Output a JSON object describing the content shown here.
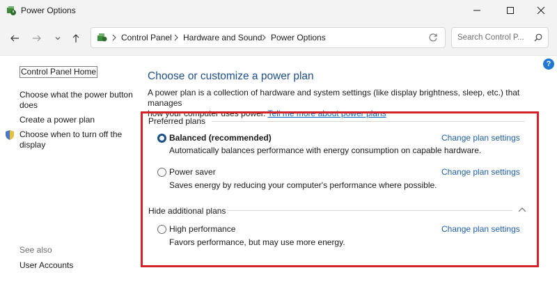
{
  "window": {
    "title": "Power Options"
  },
  "address": {
    "crumbs": [
      "Control Panel",
      "Hardware and Sound",
      "Power Options"
    ],
    "search_placeholder": "Search Control P..."
  },
  "sidebar": {
    "home": "Control Panel Home",
    "links": [
      {
        "label_line1": "Choose what the power button",
        "label_line2": "does"
      },
      {
        "label_line1": "Create a power plan"
      },
      {
        "label_line1": "Choose when to turn off the",
        "label_line2": "display"
      }
    ],
    "see_also": "See also",
    "user_accounts": "User Accounts"
  },
  "main": {
    "title": "Choose or customize a power plan",
    "description_line1": "A power plan is a collection of hardware and system settings (like display brightness, sleep, etc.) that manages",
    "description_line2_text": "how your computer uses power.",
    "description_link": "Tell me more about power plans",
    "preferred_label": "Preferred plans",
    "hide_label": "Hide additional plans",
    "change_link": "Change plan settings",
    "plans": [
      {
        "name": "Balanced (recommended)",
        "description": "Automatically balances performance with energy consumption on capable hardware.",
        "selected": true
      },
      {
        "name": "Power saver",
        "description": "Saves energy by reducing your computer's performance where possible.",
        "selected": false
      },
      {
        "name": "High performance",
        "description": "Favors performance, but may use more energy.",
        "selected": false
      }
    ]
  },
  "colors": {
    "accent": "#1e4e8c",
    "link": "#1f5fa8",
    "highlight_box": "#d2232a"
  },
  "icons": [
    "power-options-icon",
    "minimize-icon",
    "maximize-icon",
    "close-icon",
    "back-arrow-icon",
    "forward-arrow-icon",
    "chevron-down-icon",
    "up-arrow-icon",
    "control-panel-icon",
    "chevron-right-icon",
    "refresh-icon",
    "search-icon",
    "help-icon",
    "shield-icon",
    "chevron-up-icon"
  ]
}
